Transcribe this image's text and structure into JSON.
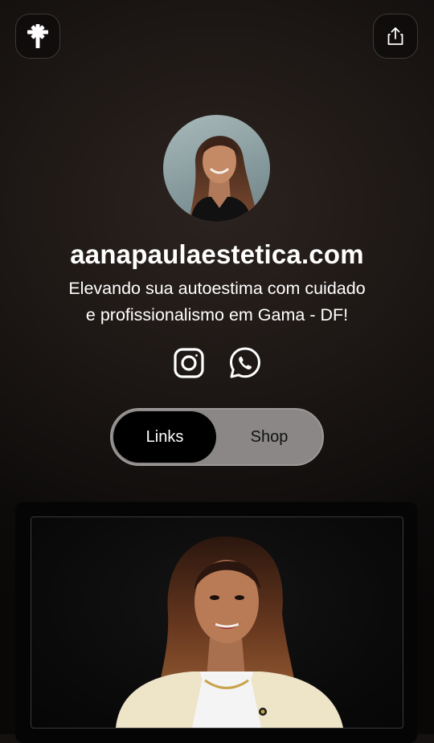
{
  "header": {
    "logo_icon": "linktree-asterisk-icon",
    "share_icon": "share-icon"
  },
  "profile": {
    "username": "aanapaulaestetica.com",
    "bio_line_1": "Elevando sua autoestima com cuidado",
    "bio_line_2": "e profissionalismo em Gama - DF!"
  },
  "socials": [
    {
      "icon": "instagram-icon"
    },
    {
      "icon": "whatsapp-icon"
    }
  ],
  "tabs": {
    "links_label": "Links",
    "shop_label": "Shop",
    "selected": "Links"
  },
  "colors": {
    "background": "#1b1614",
    "toggle_bg": "#8a8786",
    "active_tab": "#000000"
  }
}
